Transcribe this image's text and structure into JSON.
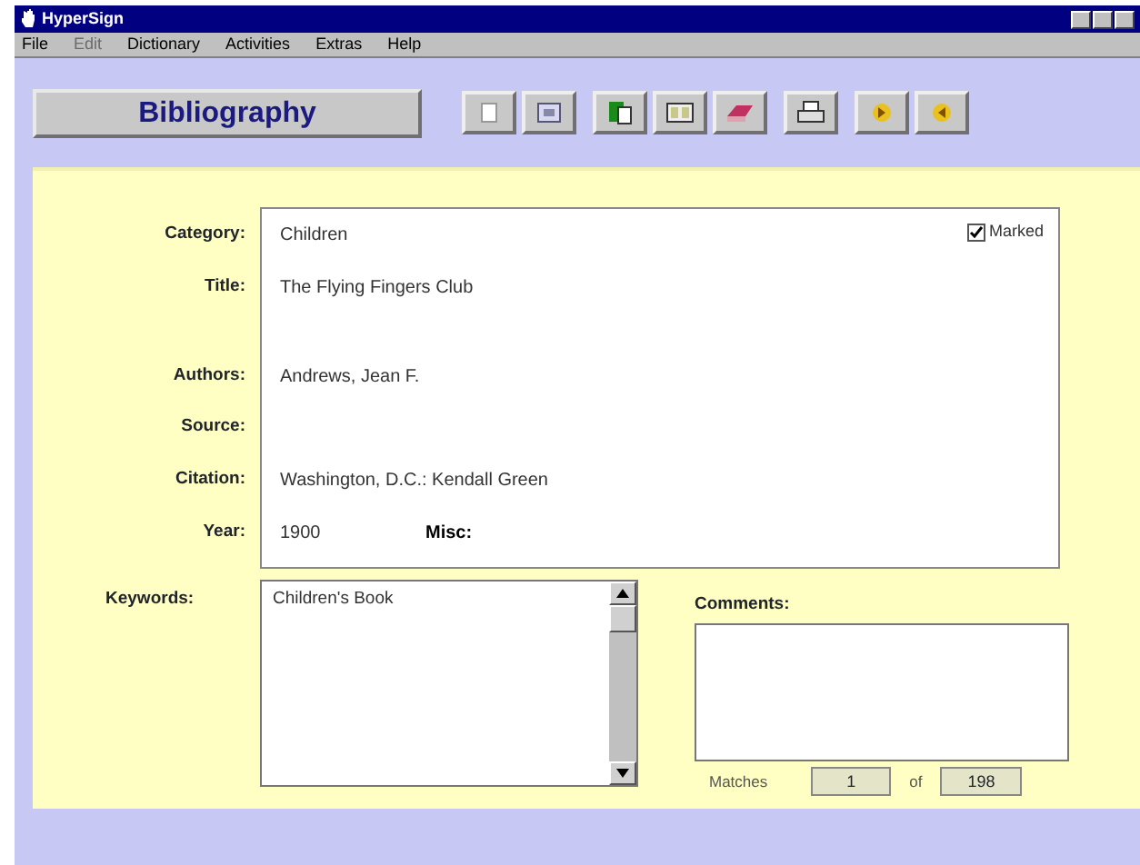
{
  "window": {
    "title": "HyperSign"
  },
  "menu": [
    {
      "label": "File",
      "disabled": false
    },
    {
      "label": "Edit",
      "disabled": true
    },
    {
      "label": "Dictionary",
      "disabled": false
    },
    {
      "label": "Activities",
      "disabled": false
    },
    {
      "label": "Extras",
      "disabled": false
    },
    {
      "label": "Help",
      "disabled": false
    }
  ],
  "section_button": "Bibliography",
  "toolbar": [
    {
      "kind": "page"
    },
    {
      "kind": "frame"
    },
    {
      "kind": "copy"
    },
    {
      "kind": "card"
    },
    {
      "kind": "eraser"
    },
    {
      "kind": "print"
    },
    {
      "kind": "next"
    },
    {
      "kind": "prev"
    }
  ],
  "record": {
    "marked": {
      "label": "Marked",
      "checked": true
    },
    "fields": [
      {
        "label": "Category:",
        "value": "Children"
      },
      {
        "label": "Title:",
        "value": "The Flying Fingers Club"
      },
      {
        "label": "Authors:",
        "value": "Andrews, Jean F."
      },
      {
        "label": "Source:"
      },
      {
        "label": "Citation:",
        "value": "Washington, D.C.: Kendall Green"
      },
      {
        "label": "Year:",
        "value": "1900"
      }
    ],
    "misc_label": "Misc:"
  },
  "keywords": {
    "label": "Keywords:",
    "items": [
      "Children's Book"
    ]
  },
  "comments": {
    "label": "Comments:"
  },
  "matches": {
    "label": "Matches",
    "current": "1",
    "of": "of",
    "total": "198"
  }
}
